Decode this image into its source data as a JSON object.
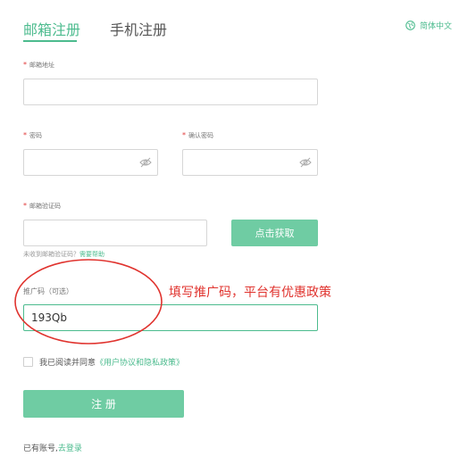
{
  "tabs": {
    "email": "邮箱注册",
    "phone": "手机注册"
  },
  "language": {
    "label": "简体中文"
  },
  "form": {
    "email_label": "邮箱地址",
    "required_mark": "*",
    "password_label": "密码",
    "confirm_label": "确认密码",
    "code_label": "邮箱验证码",
    "get_code_button": "点击获取",
    "help_text": "未收到邮箱验证码？",
    "help_link": "需要帮助",
    "invite_label": "推广码（可选）",
    "invite_value": "193Qb",
    "agree_text": "我已阅读并同意",
    "agree_link": "《用户协议和隐私政策》",
    "submit_button": "注 册",
    "login_text": "已有账号,",
    "login_link": "去登录"
  },
  "annotation": {
    "text": "填写推广码，平台有优惠政策",
    "color": "#e0332e"
  },
  "colors": {
    "accent": "#4cbb8e",
    "button": "#6fcca3",
    "required": "#e23b3b"
  }
}
